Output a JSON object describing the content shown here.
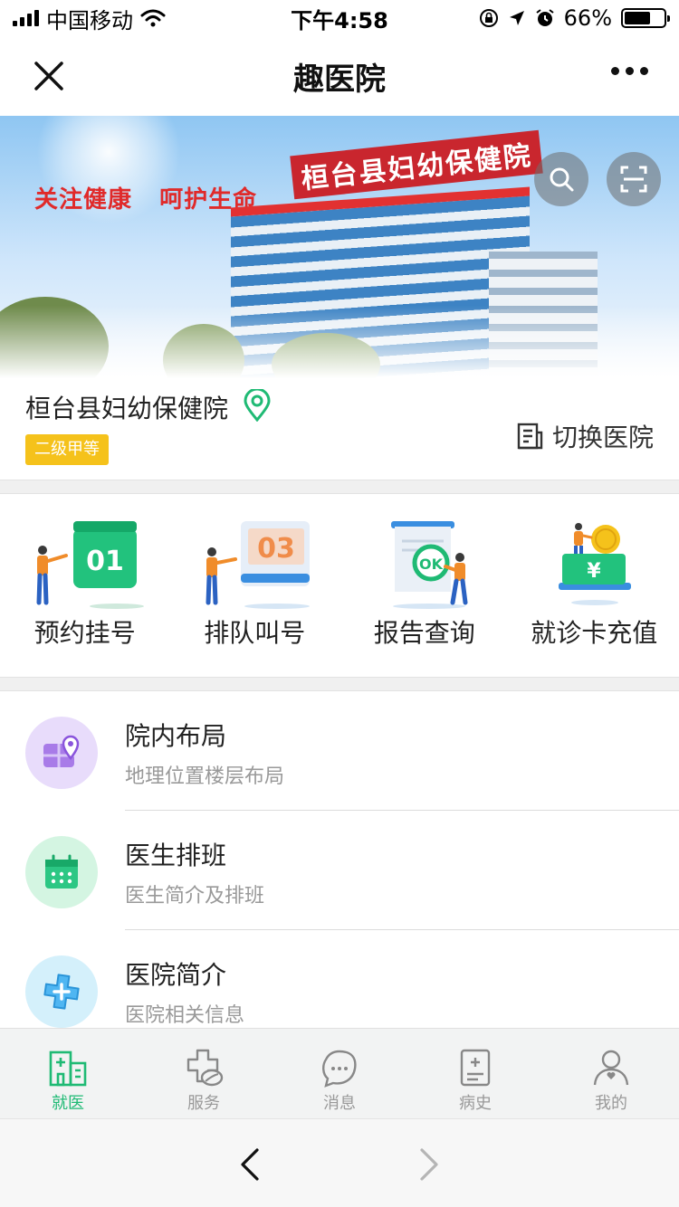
{
  "status_bar": {
    "carrier": "中国移动",
    "time": "下午4:58",
    "battery": "66%",
    "battery_level": 0.66
  },
  "nav": {
    "title": "趣医院"
  },
  "banner": {
    "slogan": "关注健康   呵护生命",
    "building_sign": "桓台县妇幼保健院"
  },
  "hospital": {
    "name": "桓台县妇幼保健院",
    "grade": "二级甲等",
    "switch_label": "切换医院"
  },
  "quick_actions": [
    {
      "label": "预约挂号",
      "number": "01"
    },
    {
      "label": "排队叫号",
      "number": "03"
    },
    {
      "label": "报告查询",
      "badge": "OK"
    },
    {
      "label": "就诊卡充值",
      "currency": "¥"
    }
  ],
  "list_items": [
    {
      "title": "院内布局",
      "subtitle": "地理位置楼层布局",
      "color": "#e8dcfb"
    },
    {
      "title": "医生排班",
      "subtitle": "医生简介及排班",
      "color": "#d4f5e2"
    },
    {
      "title": "医院简介",
      "subtitle": "医院相关信息",
      "color": "#d4f0fb"
    }
  ],
  "tabs": [
    {
      "label": "就医",
      "active": true
    },
    {
      "label": "服务",
      "active": false
    },
    {
      "label": "消息",
      "active": false
    },
    {
      "label": "病史",
      "active": false
    },
    {
      "label": "我的",
      "active": false
    }
  ],
  "colors": {
    "accent": "#1fba74",
    "badge": "#f5c21b"
  }
}
